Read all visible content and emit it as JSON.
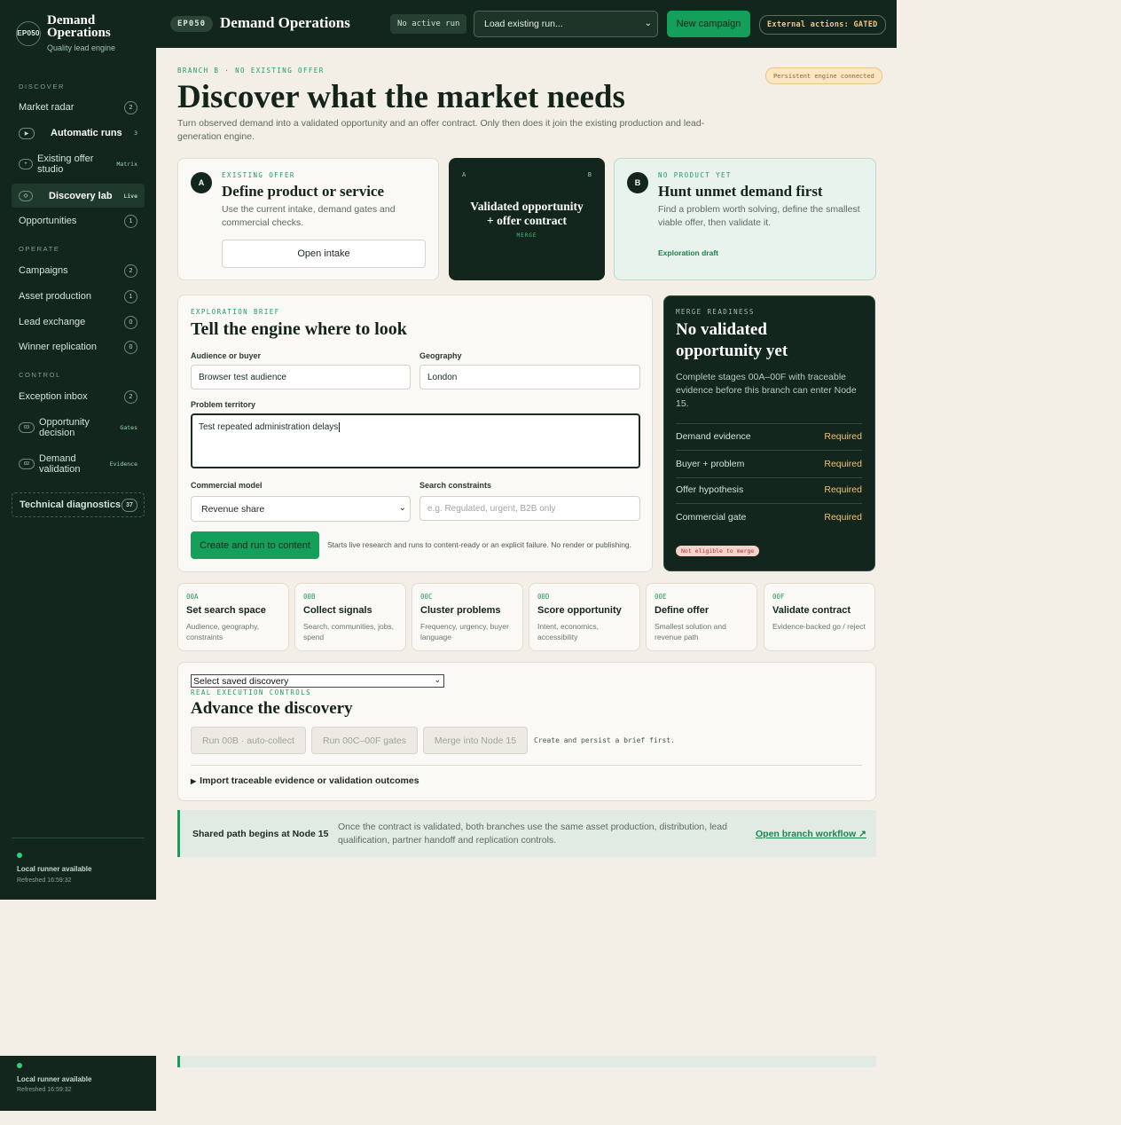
{
  "brand": {
    "logo": "EP050",
    "title_line1": "Demand",
    "title_line2": "Operations",
    "subtitle": "Quality lead engine"
  },
  "sidebar": {
    "sections": {
      "discover": "DISCOVER",
      "operate": "OPERATE",
      "control": "CONTROL"
    },
    "market_radar": {
      "label": "Market radar",
      "count": "2"
    },
    "automatic_runs": {
      "label": "Automatic runs",
      "count": "3"
    },
    "offer_studio": {
      "label": "Existing offer studio",
      "tag": "Matrix"
    },
    "discovery_lab": {
      "label": "Discovery lab",
      "tag": "Live"
    },
    "opportunities": {
      "label": "Opportunities",
      "count": "1"
    },
    "campaigns": {
      "label": "Campaigns",
      "count": "2"
    },
    "asset_production": {
      "label": "Asset production",
      "count": "1"
    },
    "lead_exchange": {
      "label": "Lead exchange",
      "count": "0"
    },
    "winner_replication": {
      "label": "Winner replication",
      "count": "0"
    },
    "exception_inbox": {
      "label": "Exception inbox",
      "count": "2"
    },
    "opportunity_decision": {
      "num": "03",
      "label": "Opportunity decision",
      "tag": "Gates"
    },
    "demand_validation": {
      "num": "02",
      "label": "Demand validation",
      "tag": "Evidence"
    },
    "diagnostics": {
      "label": "Technical diagnostics",
      "count": "37"
    },
    "footer": {
      "status": "Local runner available",
      "refreshed": "Refreshed 16:59:32"
    }
  },
  "topbar": {
    "ep": "EP050",
    "title": "Demand Operations",
    "no_run": "No active run",
    "load_run": "Load existing run...",
    "new_campaign": "New campaign",
    "external": "External actions: GATED"
  },
  "header": {
    "eyebrow": "BRANCH B · NO EXISTING OFFER",
    "persist": "Persistent engine connected",
    "title": "Discover what the market needs",
    "lead": "Turn observed demand into a validated opportunity and an offer contract. Only then does it join the existing production and lead-generation engine."
  },
  "branch_a": {
    "badge": "A",
    "eyebrow": "EXISTING OFFER",
    "title": "Define product or service",
    "desc": "Use the current intake, demand gates and commercial checks.",
    "button": "Open intake"
  },
  "merge_card": {
    "left": "A",
    "right": "B",
    "title_line1": "Validated opportunity",
    "title_line2": "+ offer contract",
    "label": "MERGE"
  },
  "branch_b": {
    "badge": "B",
    "eyebrow": "NO PRODUCT YET",
    "title": "Hunt unmet demand first",
    "desc": "Find a problem worth solving, define the smallest viable offer, then validate it.",
    "link": "Exploration draft"
  },
  "brief": {
    "eyebrow": "EXPLORATION BRIEF",
    "title": "Tell the engine where to look",
    "audience_label": "Audience or buyer",
    "audience_value": "Browser test audience",
    "geo_label": "Geography",
    "geo_value": "London",
    "problem_label": "Problem territory",
    "problem_value": "Test repeated administration delays",
    "model_label": "Commercial model",
    "model_value": "Revenue share",
    "constraints_label": "Search constraints",
    "constraints_placeholder": "e.g. Regulated, urgent, B2B only",
    "run_button": "Create and run to content",
    "run_note": "Starts live research and runs to content-ready or an explicit failure. No render or publishing."
  },
  "merge_readiness": {
    "eyebrow": "MERGE READINESS",
    "title_line1": "No validated",
    "title_line2": "opportunity yet",
    "desc": "Complete stages 00A–00F with traceable evidence before this branch can enter Node 15.",
    "rows": [
      {
        "label": "Demand evidence",
        "value": "Required"
      },
      {
        "label": "Buyer + problem",
        "value": "Required"
      },
      {
        "label": "Offer hypothesis",
        "value": "Required"
      },
      {
        "label": "Commercial gate",
        "value": "Required"
      }
    ],
    "status": "Not eligible to merge"
  },
  "stages": [
    {
      "code": "00A",
      "title": "Set search space",
      "desc": "Audience, geography, constraints"
    },
    {
      "code": "00B",
      "title": "Collect signals",
      "desc": "Search, communities, jobs, spend"
    },
    {
      "code": "00C",
      "title": "Cluster problems",
      "desc": "Frequency, urgency, buyer language"
    },
    {
      "code": "00D",
      "title": "Score opportunity",
      "desc": "Intent, economics, accessibility"
    },
    {
      "code": "00E",
      "title": "Define offer",
      "desc": "Smallest solution and revenue path"
    },
    {
      "code": "00F",
      "title": "Validate contract",
      "desc": "Evidence-backed go / reject"
    }
  ],
  "controls": {
    "saved_select": "Select saved discovery",
    "eyebrow": "REAL EXECUTION CONTROLS",
    "title": "Advance the discovery",
    "run_00b": "Run 00B · auto-collect",
    "run_00c": "Run 00C–00F gates",
    "merge": "Merge into Node 15",
    "note": "Create and persist a brief first.",
    "import": "Import traceable evidence or validation outcomes"
  },
  "shared": {
    "title": "Shared path begins at Node 15",
    "desc": "Once the contract is validated, both branches use the same asset production, distribution, lead qualification, partner handoff and replication controls.",
    "link": "Open branch workflow ↗"
  },
  "colors": {
    "sidebar": "#12261d",
    "accent": "#14a05b",
    "background": "#f3efe7",
    "required": "#f0c274"
  }
}
